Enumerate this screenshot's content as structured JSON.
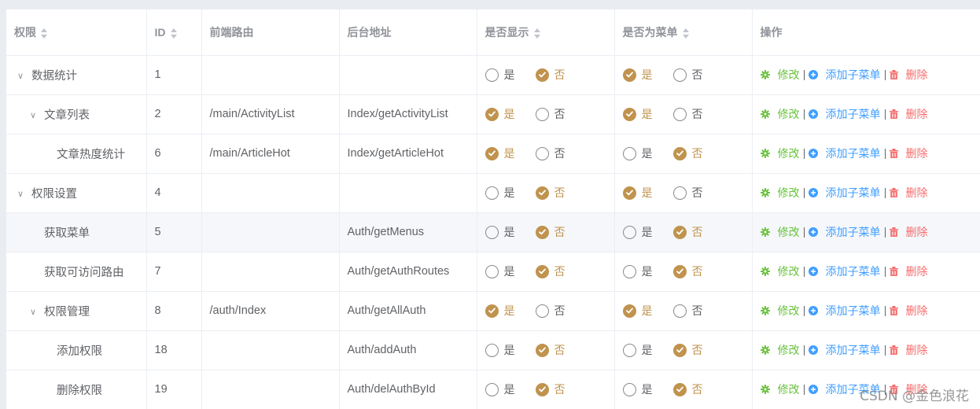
{
  "headers": {
    "name": "权限",
    "id": "ID",
    "route": "前端路由",
    "backend": "后台地址",
    "is_show": "是否显示",
    "is_menu": "是否为菜单",
    "actions": "操作"
  },
  "yes_label": "是",
  "no_label": "否",
  "action_labels": {
    "edit": "修改",
    "add_child": "添加子菜单",
    "delete": "删除"
  },
  "colors": {
    "accent": "#c0934e",
    "edit": "#67c23a",
    "add": "#409eff",
    "delete": "#f56c6c"
  },
  "rows": [
    {
      "name": "数据统计",
      "level": 0,
      "expandable": true,
      "id": "1",
      "route": "",
      "backend": "",
      "show": false,
      "menu": true
    },
    {
      "name": "文章列表",
      "level": 1,
      "expandable": true,
      "id": "2",
      "route": "/main/ActivityList",
      "backend": "Index/getActivityList",
      "show": true,
      "menu": true
    },
    {
      "name": "文章热度统计",
      "level": 2,
      "expandable": false,
      "id": "6",
      "route": "/main/ArticleHot",
      "backend": "Index/getArticleHot",
      "show": true,
      "menu": false
    },
    {
      "name": "权限设置",
      "level": 0,
      "expandable": true,
      "id": "4",
      "route": "",
      "backend": "",
      "show": false,
      "menu": true
    },
    {
      "name": "获取菜单",
      "level": 1,
      "expandable": false,
      "id": "5",
      "route": "",
      "backend": "Auth/getMenus",
      "show": false,
      "menu": false,
      "hover": true
    },
    {
      "name": "获取可访问路由",
      "level": 1,
      "expandable": false,
      "id": "7",
      "route": "",
      "backend": "Auth/getAuthRoutes",
      "show": false,
      "menu": false
    },
    {
      "name": "权限管理",
      "level": 1,
      "expandable": true,
      "id": "8",
      "route": "/auth/Index",
      "backend": "Auth/getAllAuth",
      "show": true,
      "menu": true
    },
    {
      "name": "添加权限",
      "level": 2,
      "expandable": false,
      "id": "18",
      "route": "",
      "backend": "Auth/addAuth",
      "show": false,
      "menu": false
    },
    {
      "name": "删除权限",
      "level": 2,
      "expandable": false,
      "id": "19",
      "route": "",
      "backend": "Auth/delAuthById",
      "show": false,
      "menu": false
    }
  ],
  "watermark": "CSDN @金色浪花"
}
